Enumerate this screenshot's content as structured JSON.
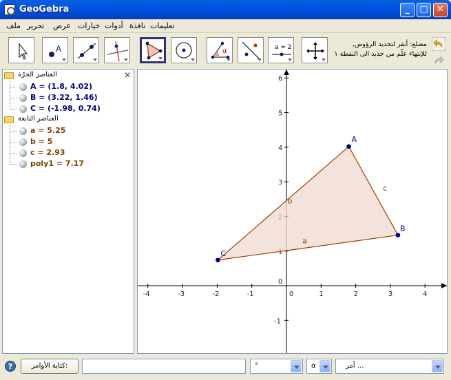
{
  "window": {
    "title": "GeoGebra",
    "min_glyph": "_",
    "max_glyph": "□",
    "close_glyph": "✕"
  },
  "menu": [
    "ملف",
    "تحرير",
    "عرض",
    "خيارات",
    "أدوات",
    "نافذة",
    "تعليمات"
  ],
  "toolbar": {
    "tools": [
      {
        "name": "move-tool-icon",
        "selected": false
      },
      {
        "name": "new-point-tool-icon",
        "selected": false
      },
      {
        "name": "line-through-two-points-tool-icon",
        "selected": false
      },
      {
        "name": "perpendicular-line-tool-icon",
        "selected": false
      },
      {
        "name": "polygon-tool-icon",
        "selected": true
      },
      {
        "name": "circle-with-center-tool-icon",
        "selected": false
      },
      {
        "name": "angle-tool-icon",
        "selected": false
      },
      {
        "name": "reflect-about-line-tool-icon",
        "selected": false
      },
      {
        "name": "slider-tool-icon",
        "selected": false
      },
      {
        "name": "move-graphics-view-tool-icon",
        "selected": false
      }
    ],
    "slider_label": "a = 2",
    "angle_label": "α",
    "help_line1": "مضلع: أنقر لتحديد الرؤوس,",
    "help_line2": "للإنتهاء علّم من جديد الى النقطة ١"
  },
  "algebra": {
    "close": "✕",
    "free_folder": "العناصر الحرّة",
    "dependent_folder": "العناصر التابعة",
    "free_objects": [
      "A = (1.8, 4.02)",
      "B = (3.22, 1.46)",
      "C = (-1.98, 0.74)"
    ],
    "dependent_objects": [
      "a = 5.25",
      "b = 5",
      "c = 2.93",
      "poly1 = 7.17"
    ]
  },
  "graphics": {
    "x_ticks": [
      "-4",
      "-3",
      "-2",
      "-1",
      "0",
      "1",
      "2",
      "3",
      "4"
    ],
    "y_ticks": [
      "6",
      "5",
      "4",
      "3",
      "2",
      "1",
      "0",
      "-1"
    ],
    "points": [
      {
        "label": "A",
        "x": 1.8,
        "y": 4.02
      },
      {
        "label": "B",
        "x": 3.22,
        "y": 1.46
      },
      {
        "label": "C",
        "x": -1.98,
        "y": 0.74
      }
    ],
    "segment_labels": [
      "a",
      "b",
      "c"
    ],
    "colors": {
      "point": "#00007f",
      "polygon_stroke": "#a04000",
      "polygon_fill": "#f0d8d0",
      "segment_label": "#7f3f00"
    }
  },
  "inputbar": {
    "help": "?",
    "command_label": "كتابة الأوامر:",
    "degree_value": "°",
    "alpha_value": "α",
    "command_value": "أمر ..."
  }
}
